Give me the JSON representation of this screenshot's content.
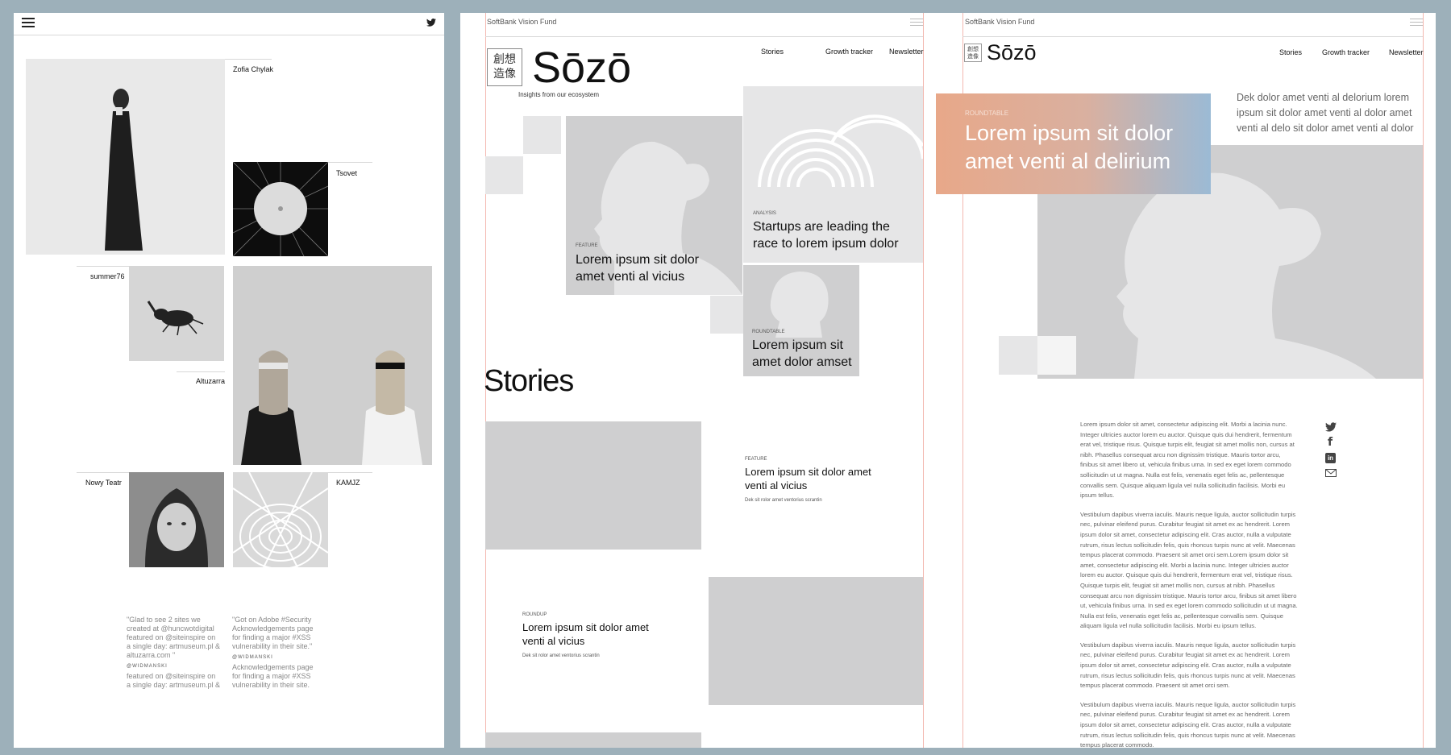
{
  "left_site": {
    "names": [
      "Zofia Chylak",
      "Tsovet",
      "summer76",
      "Altuzarra",
      "Nowy Teatr",
      "KAMJZ"
    ],
    "quotes": [
      [
        "\"Glad to see 2 sites we",
        "created at @huncwotdigital",
        "featured on @siteinspire on",
        "a single day: artmuseum.pl &",
        "altuzarra.com \""
      ],
      [
        "\"Got on Adobe #Security",
        "Acknowledgements page",
        "for finding a major #XSS",
        "vulnerability in their site.\""
      ]
    ],
    "quote_author": "@WIDMANSKI",
    "quote_tail_1": [
      "featured on @siteinspire on",
      "a single day: artmuseum.pl &"
    ],
    "quote_tail_2": [
      "Acknowledgements page",
      "for finding a major #XSS",
      "vulnerability in their site."
    ]
  },
  "sozo_home": {
    "brand_small": "SoftBank Vision Fund",
    "logo_kanji": [
      "創想",
      "造像"
    ],
    "logo_text": "Sōzō",
    "tagline": "Insights from our ecosystem",
    "nav": [
      "Stories",
      "Growth tracker",
      "Newsletter"
    ],
    "feature_card": {
      "kicker": "FEATURE",
      "title_lines": [
        "Lorem ipsum sit dolor",
        "amet venti al vicius"
      ]
    },
    "analysis_card": {
      "kicker": "ANALYSIS",
      "title_lines": [
        "Startups are leading the",
        "race to lorem ipsum dolor"
      ]
    },
    "roundtable_card": {
      "kicker": "ROUNDTABLE",
      "title_lines": [
        "Lorem ipsum sit",
        "amet dolor amset"
      ]
    },
    "stories_heading": "Stories",
    "story1": {
      "kicker": "FEATURE",
      "title_lines": [
        "Lorem ipsum sit dolor amet",
        "venti al vicius"
      ],
      "desc": "Dek sit rolor amet ventorius scrantin"
    },
    "story2": {
      "kicker": "ROUNDUP",
      "title_lines": [
        "Lorem ipsum sit dolor amet",
        "venti al vicius"
      ],
      "desc": "Dek sit rolor amet ventorius scrantin"
    }
  },
  "sozo_article": {
    "brand_small": "SoftBank Vision Fund",
    "logo_kanji": [
      "創想",
      "造像"
    ],
    "logo_text": "Sōzō",
    "nav": [
      "Stories",
      "Growth tracker",
      "Newsletter"
    ],
    "hero_kicker": "ROUNDTABLE",
    "hero_title_lines": [
      "Lorem ipsum sit dolor",
      "amet venti al delirium"
    ],
    "dek_lines": [
      "Dek dolor amet venti al delorium lorem",
      "ipsum sit dolor amet venti al dolor amet",
      "venti al delo sit dolor amet venti al dolor"
    ],
    "share_icons": [
      "twitter-icon",
      "facebook-icon",
      "linkedin-icon",
      "mail-icon"
    ],
    "paragraphs": [
      [
        "Lorem ipsum dolor sit amet, consectetur adipiscing elit. Morbi a lacinia nunc.",
        "Integer ultricies auctor lorem eu auctor. Quisque quis dui hendrerit, fermentum",
        "erat vel, tristique risus. Quisque turpis elit, feugiat sit amet mollis non, cursus at",
        "nibh. Phasellus consequat arcu non dignissim tristique. Mauris tortor arcu,",
        "finibus sit amet libero ut, vehicula finibus urna. In sed ex eget lorem commodo",
        "sollicitudin ut ut magna. Nulla est felis, venenatis eget felis ac, pellentesque",
        "convallis sem. Quisque aliquam ligula vel nulla sollicitudin facilisis. Morbi eu",
        "ipsum tellus."
      ],
      [
        "Vestibulum dapibus viverra iaculis. Mauris neque ligula, auctor sollicitudin turpis",
        "nec, pulvinar eleifend purus. Curabitur feugiat sit amet ex ac hendrerit. Lorem",
        "ipsum dolor sit amet, consectetur adipiscing elit. Cras auctor, nulla a vulputate",
        "rutrum, risus lectus sollicitudin felis, quis rhoncus turpis nunc at velit. Maecenas",
        "tempus placerat commodo. Praesent sit amet orci sem.Lorem ipsum dolor sit",
        "amet, consectetur adipiscing elit. Morbi a lacinia nunc. Integer ultricies auctor",
        "lorem eu auctor. Quisque quis dui hendrerit, fermentum erat vel, tristique risus.",
        "Quisque turpis elit, feugiat sit amet mollis non, cursus at nibh. Phasellus",
        "consequat arcu non dignissim tristique. Mauris tortor arcu, finibus sit amet libero",
        "ut, vehicula finibus urna. In sed ex eget lorem commodo sollicitudin ut ut magna.",
        "Nulla est felis, venenatis eget felis ac, pellentesque convallis sem. Quisque",
        "aliquam ligula vel nulla sollicitudin facilisis. Morbi eu ipsum tellus."
      ],
      [
        "Vestibulum dapibus viverra iaculis. Mauris neque ligula, auctor sollicitudin turpis",
        "nec, pulvinar eleifend purus. Curabitur feugiat sit amet ex ac hendrerit. Lorem",
        "ipsum dolor sit amet, consectetur adipiscing elit. Cras auctor, nulla a vulputate",
        "rutrum, risus lectus sollicitudin felis, quis rhoncus turpis nunc at velit. Maecenas",
        "tempus placerat commodo. Praesent sit amet orci sem."
      ],
      [
        "Vestibulum dapibus viverra iaculis. Mauris neque ligula, auctor sollicitudin turpis",
        "nec, pulvinar eleifend purus. Curabitur feugiat sit amet ex ac hendrerit. Lorem",
        "ipsum dolor sit amet, consectetur adipiscing elit. Cras auctor, nulla a vulputate",
        "rutrum, risus lectus sollicitudin felis, quis rhoncus turpis nunc at velit. Maecenas",
        "tempus placerat commodo."
      ]
    ]
  },
  "colors": {
    "bg": "#9db0ba",
    "card_gray": "#cfcfd0",
    "light_gray": "#e6e6e7",
    "guide_red": "#f3b8b0",
    "hero_orange": "#e8a889",
    "hero_blue": "#9bbad5"
  }
}
